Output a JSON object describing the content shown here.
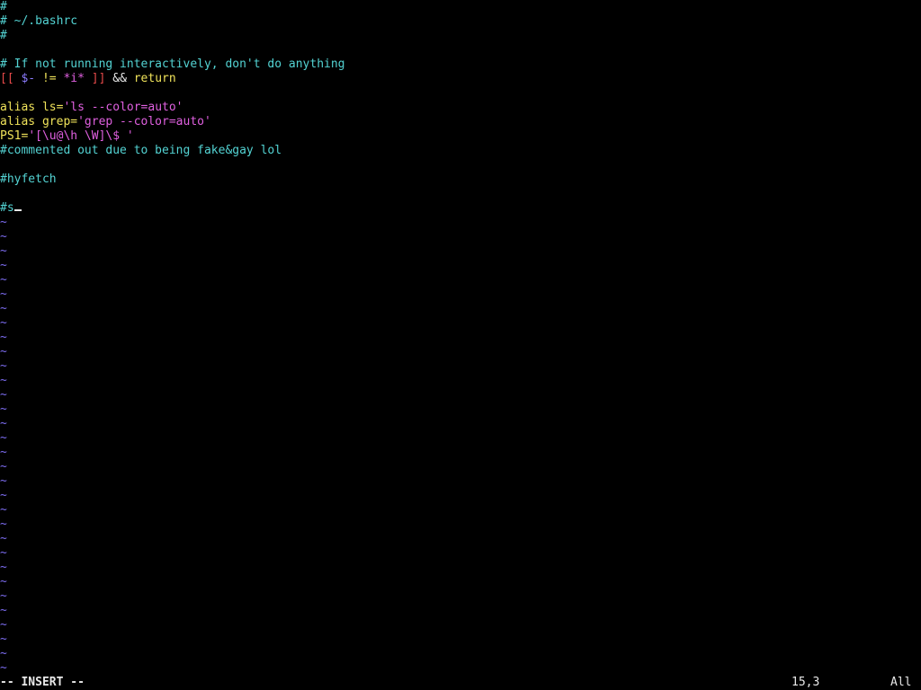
{
  "colors": {
    "comment": "#53d3d3",
    "keyword": "#f0e35a",
    "string": "#e060e0",
    "bracket": "#e84a4a",
    "variable": "#8c7cff",
    "normal": "#e8e8e8",
    "tilde": "#7c6cf0",
    "background": "#000000"
  },
  "buffer": {
    "lines": [
      [
        {
          "t": "#",
          "c": "comment"
        }
      ],
      [
        {
          "t": "# ~/.bashrc",
          "c": "comment"
        }
      ],
      [
        {
          "t": "#",
          "c": "comment"
        }
      ],
      [],
      [
        {
          "t": "# If not running interactively, don't do anything",
          "c": "comment"
        }
      ],
      [
        {
          "t": "[[ ",
          "c": "bracket"
        },
        {
          "t": "$-",
          "c": "variable"
        },
        {
          "t": " ",
          "c": "normal"
        },
        {
          "t": "!=",
          "c": "keyword"
        },
        {
          "t": " ",
          "c": "normal"
        },
        {
          "t": "*i*",
          "c": "string"
        },
        {
          "t": " ]]",
          "c": "bracket"
        },
        {
          "t": " && ",
          "c": "normal"
        },
        {
          "t": "return",
          "c": "keyword"
        }
      ],
      [],
      [
        {
          "t": "alias ls=",
          "c": "keyword"
        },
        {
          "t": "'ls --color=auto'",
          "c": "string"
        }
      ],
      [
        {
          "t": "alias grep=",
          "c": "keyword"
        },
        {
          "t": "'grep --color=auto'",
          "c": "string"
        }
      ],
      [
        {
          "t": "PS1=",
          "c": "keyword"
        },
        {
          "t": "'[\\u@\\h \\W]\\$ '",
          "c": "string"
        }
      ],
      [
        {
          "t": "#commented out due to being fake&gay lol",
          "c": "comment"
        }
      ],
      [],
      [
        {
          "t": "#hyfetch",
          "c": "comment"
        }
      ],
      [],
      [
        {
          "t": "#s",
          "c": "comment"
        }
      ]
    ],
    "cursor_line": 14,
    "tilde_char": "~",
    "tilde_count": 32
  },
  "status": {
    "mode": "-- INSERT --",
    "position": "15,3",
    "percent": "All"
  }
}
